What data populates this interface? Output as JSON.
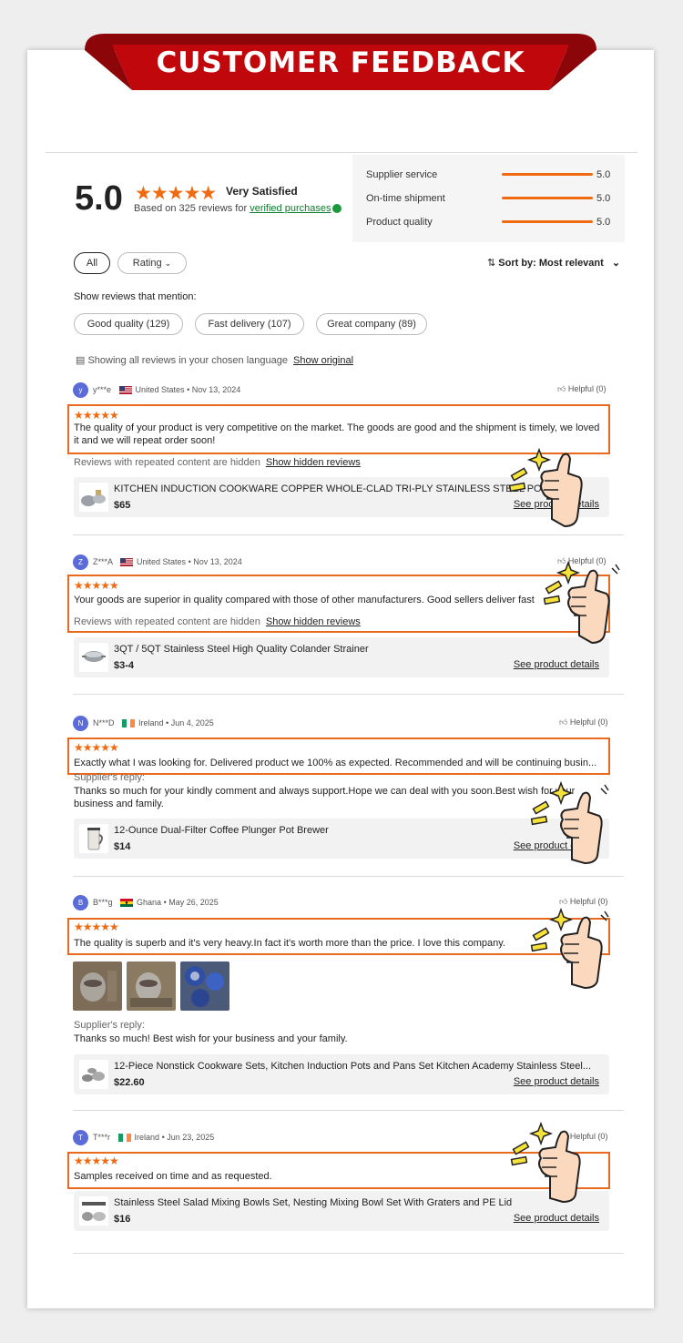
{
  "banner": {
    "title": "CUSTOMER FEEDBACK"
  },
  "summary": {
    "score": "5.0",
    "stars": "★★★★★",
    "label": "Very Satisfied",
    "based_prefix": "Based on 325 reviews for",
    "verified": "verified purchases"
  },
  "metrics": [
    {
      "name": "Supplier service",
      "value": "5.0",
      "fill": 1.0
    },
    {
      "name": "On-time shipment",
      "value": "5.0",
      "fill": 1.0
    },
    {
      "name": "Product quality",
      "value": "5.0",
      "fill": 1.0
    }
  ],
  "filters": {
    "all": "All",
    "rating": "Rating",
    "sort": "Sort by: Most relevant"
  },
  "mention": {
    "label": "Show reviews that mention:",
    "tags": [
      "Good quality (129)",
      "Fast delivery (107)",
      "Great company (89)"
    ]
  },
  "language": {
    "note": "Showing all reviews in your chosen language",
    "link": "Show original"
  },
  "common": {
    "helpful": "Helpful (0)",
    "see_details": "See product details",
    "hidden_note": "Reviews with repeated content are hidden",
    "hidden_link": "Show hidden reviews",
    "supplier_reply": "Supplier's reply:",
    "stars": "★★★★★"
  },
  "reviews": [
    {
      "initial": "y",
      "user": "y***e",
      "country": "United States",
      "date": "Nov 13, 2024",
      "text": "The quality of your product is very competitive on the market.  The goods are good and the shipment is timely,   we loved it and we will repeat order soon!",
      "product": {
        "name": "KITCHEN INDUCTION COOKWARE COPPER WHOLE-CLAD TRI-PLY STAINLESS STEEL POTS PAN",
        "price": "$65"
      }
    },
    {
      "initial": "Z",
      "user": "Z***A",
      "country": "United States",
      "date": "Nov 13, 2024",
      "text": "Your goods are superior in quality compared with those of other manufacturers. Good sellers deliver fast",
      "product": {
        "name": "3QT / 5QT Stainless Steel High Quality Colander Strainer",
        "price": "$3-4"
      }
    },
    {
      "initial": "N",
      "user": "N***D",
      "country": "Ireland",
      "date": "Jun 4, 2025",
      "text": "Exactly what I was looking for. Delivered product we 100% as expected. Recommended and will be continuing busin...",
      "reply": "Thanks so much for your kindly comment and always support.Hope we can deal with you soon.Best wish for your business and family.",
      "product": {
        "name": "12-Ounce Dual-Filter Coffee Plunger Pot Brewer",
        "price": "$14"
      }
    },
    {
      "initial": "B",
      "user": "B***g",
      "country": "Ghana",
      "date": "May 26, 2025",
      "text": "The quality is superb and it's very heavy.In fact it's worth more than the price. I love this company.",
      "reply": "Thanks so much! Best wish for your business and your family.",
      "product": {
        "name": "12-Piece Nonstick Cookware Sets, Kitchen Induction Pots and Pans Set Kitchen Academy Stainless Steel...",
        "price": "$22.60"
      }
    },
    {
      "initial": "T",
      "user": "T***r",
      "country": "Ireland",
      "date": "Jun 23, 2025",
      "text": "Samples received on time and as requested.",
      "product": {
        "name": "Stainless Steel Salad Mixing Bowls Set, Nesting Mixing Bowl Set With Graters and PE Lid",
        "price": "$16"
      }
    }
  ],
  "colors": {
    "banner": "#c0070b",
    "accent": "#f06a12",
    "box": "#e96a1e",
    "verified": "#0a7a2c"
  }
}
